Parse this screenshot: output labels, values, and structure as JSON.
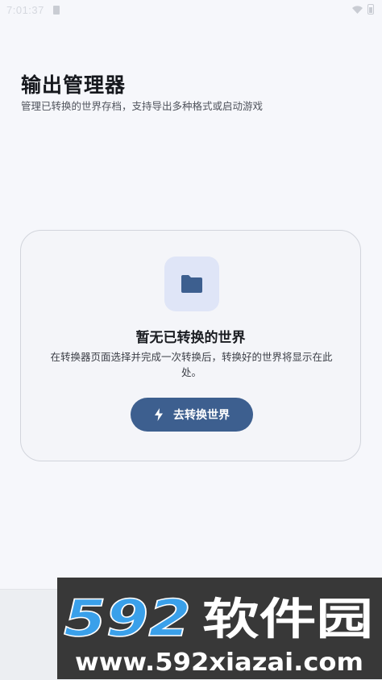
{
  "status_bar": {
    "time": "7:01:37"
  },
  "header": {
    "title": "输出管理器",
    "subtitle": "管理已转换的世界存档，支持导出多种格式或启动游戏"
  },
  "empty_state": {
    "icon": "folder-icon",
    "title": "暂无已转换的世界",
    "description": "在转换器页面选择并完成一次转换后，转换好的世界将显示在此处。",
    "button_label": "去转换世界",
    "button_icon": "lightning-icon"
  },
  "watermark": {
    "brand_number": "592",
    "brand_text": "软件园",
    "url": "www.592xiazai.com"
  },
  "colors": {
    "background": "#f6f7fb",
    "accent": "#3d5f8f",
    "icon_tile": "#dfe5f7",
    "watermark_blue": "#3aa0ea"
  }
}
